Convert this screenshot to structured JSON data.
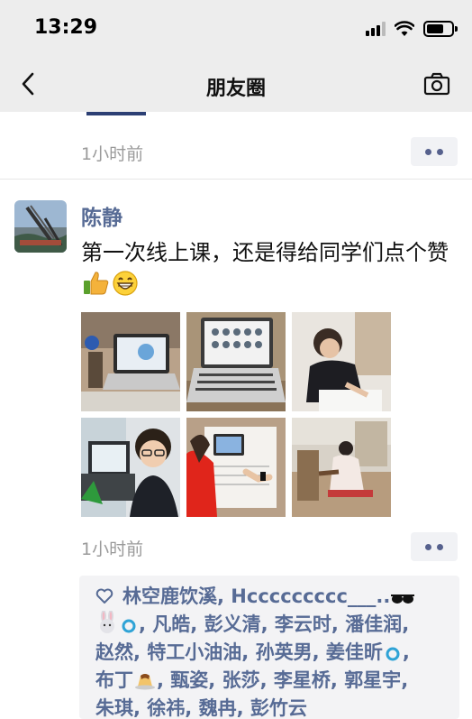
{
  "status_bar": {
    "time": "13:29"
  },
  "nav": {
    "title": "朋友圈"
  },
  "previous_post": {
    "time": "1小时前"
  },
  "post": {
    "author": "陈静",
    "text": "第一次线上课，还是得给同学们点个赞",
    "time": "1小时前",
    "photos": [
      "photo-1",
      "photo-2",
      "photo-3",
      "photo-4",
      "photo-5",
      "photo-6"
    ]
  },
  "likes": {
    "names": [
      "林空鹿饮溪",
      "Hccccccccc___..",
      "",
      "凡皓",
      "彭义清",
      "李云时",
      "潘佳润",
      "赵然",
      "特工小油油",
      "孙英男",
      "姜佳昕",
      "布丁",
      "甄姿",
      "张莎",
      "李星桥",
      "郭星宇",
      "朱琪",
      "徐祎",
      "魏冉",
      "彭竹云"
    ]
  },
  "colors": {
    "link": "#576b95",
    "timestamp": "#9a9a9a",
    "nav_bg": "#ededed",
    "likes_bg": "#f3f3f5"
  },
  "icons": [
    "back-icon",
    "camera-icon",
    "more-dots-icon",
    "heart-icon",
    "thumbs-up-emoji",
    "grin-emoji",
    "sunglasses-emoji",
    "rabbit-emoji",
    "ring-emoji",
    "pudding-emoji"
  ]
}
